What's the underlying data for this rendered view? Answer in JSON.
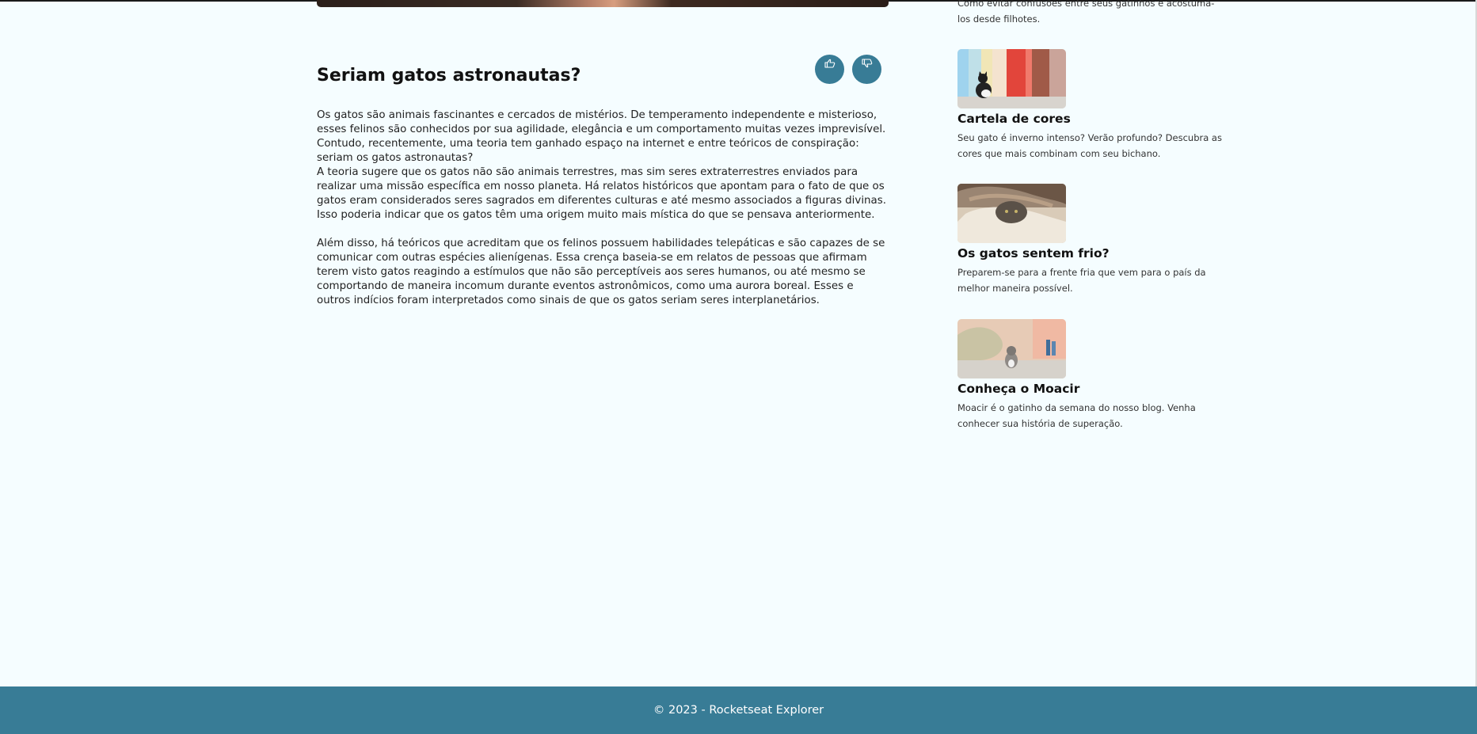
{
  "article": {
    "title": "Seriam gatos astronautas?",
    "paragraphs": [
      "Os gatos são animais fascinantes e cercados de mistérios. De temperamento independente e misterioso, esses felinos são conhecidos por sua agilidade, elegância e um comportamento muitas vezes imprevisível. Contudo, recentemente, uma teoria tem ganhado espaço na internet e entre teóricos de conspiração: seriam os gatos astronautas?",
      "A teoria sugere que os gatos não são animais terrestres, mas sim seres extraterrestres enviados para realizar uma missão específica em nosso planeta. Há relatos históricos que apontam para o fato de que os gatos eram considerados seres sagrados em diferentes culturas e até mesmo associados a figuras divinas. Isso poderia indicar que os gatos têm uma origem muito mais mística do que se pensava anteriormente.",
      "Além disso, há teóricos que acreditam que os felinos possuem habilidades telepáticas e são capazes de se comunicar com outras espécies alienígenas. Essa crença baseia-se em relatos de pessoas que afirmam terem visto gatos reagindo a estímulos que não são perceptíveis aos seres humanos, ou até mesmo se comportando de maneira incomum durante eventos astronômicos, como uma aurora boreal. Esses e outros indícios foram interpretados como sinais de que os gatos seriam seres interplanetários."
    ],
    "like_icon": "thumbs-up-icon",
    "dislike_icon": "thumbs-down-icon"
  },
  "sidebar": {
    "intro_text": "Como evitar confusões entre seus gatinhos e acostumá-los desde filhotes.",
    "cards": [
      {
        "title": "Cartela de cores",
        "text": "Seu gato é inverno intenso? Verão profundo? Descubra as cores que mais combinam com seu bichano."
      },
      {
        "title": "Os gatos sentem frio?",
        "text": "Preparem-se para a frente fria que vem para o país da melhor maneira possível."
      },
      {
        "title": "Conheça o Moacir",
        "text": "Moacir é o gatinho da semana do nosso blog. Venha conhecer sua história de superação."
      }
    ]
  },
  "footer": {
    "text": "© 2023 - Rocketseat Explorer"
  },
  "colors": {
    "accent": "#387c96",
    "background": "#f5fdff"
  }
}
